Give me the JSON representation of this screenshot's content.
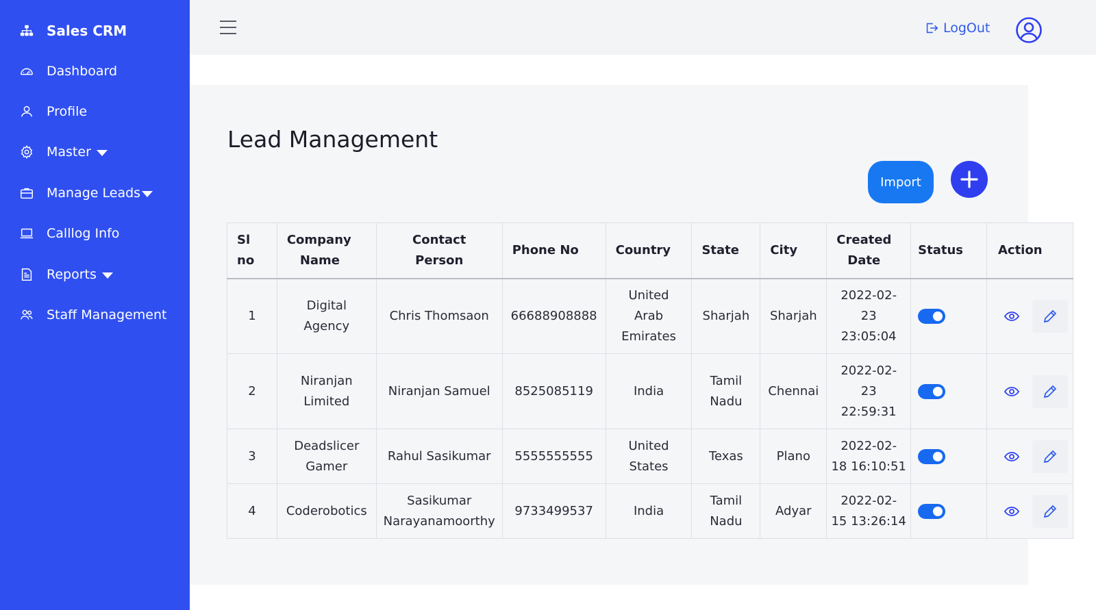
{
  "sidebar": {
    "brand": "Sales CRM",
    "items": [
      {
        "label": "Dashboard"
      },
      {
        "label": "Profile"
      },
      {
        "label": "Master"
      },
      {
        "label": "Manage Leads"
      },
      {
        "label": "Calllog Info"
      },
      {
        "label": "Reports"
      },
      {
        "label": "Staff Management"
      }
    ]
  },
  "topbar": {
    "logout_label": "LogOut"
  },
  "main": {
    "title": "Lead Management",
    "import_label": "Import",
    "add_label": "+"
  },
  "table": {
    "headers": {
      "sl_no_1": "Sl",
      "sl_no_2": "no",
      "company_1": "Company",
      "company_2": "Name",
      "contact_1": "Contact",
      "contact_2": "Person",
      "phone": "Phone No",
      "country": "Country",
      "state": "State",
      "city": "City",
      "created_1": "Created",
      "created_2": "Date",
      "status": "Status",
      "action": "Action"
    },
    "rows": [
      {
        "sl": "1",
        "company": [
          "Digital",
          "Agency"
        ],
        "contact": [
          "Chris Thomsaon"
        ],
        "phone": "66688908888",
        "country": [
          "United",
          "Arab",
          "Emirates"
        ],
        "state": [
          "Sharjah"
        ],
        "city": "Sharjah",
        "created": [
          "2022-02-",
          "23",
          "23:05:04"
        ],
        "status_on": true
      },
      {
        "sl": "2",
        "company": [
          "Niranjan",
          "Limited"
        ],
        "contact": [
          "Niranjan Samuel"
        ],
        "phone": "8525085119",
        "country": [
          "India"
        ],
        "state": [
          "Tamil",
          "Nadu"
        ],
        "city": "Chennai",
        "created": [
          "2022-02-",
          "23",
          "22:59:31"
        ],
        "status_on": true
      },
      {
        "sl": "3",
        "company": [
          "Deadslicer",
          "Gamer"
        ],
        "contact": [
          "Rahul Sasikumar"
        ],
        "phone": "5555555555",
        "country": [
          "United",
          "States"
        ],
        "state": [
          "Texas"
        ],
        "city": "Plano",
        "created": [
          "2022-02-",
          "18 16:10:51"
        ],
        "status_on": true
      },
      {
        "sl": "4",
        "company": [
          "Coderobotics"
        ],
        "contact": [
          "Sasikumar",
          "Narayanamoorthy"
        ],
        "phone": "9733499537",
        "country": [
          "India"
        ],
        "state": [
          "Tamil",
          "Nadu"
        ],
        "city": "Adyar",
        "created": [
          "2022-02-",
          "15 13:26:14"
        ],
        "status_on": true
      }
    ]
  },
  "colors": {
    "sidebar": "#2f4ff0",
    "import_button": "#1778f2",
    "add_button": "#2f3ff0",
    "toggle_on": "#1769f0",
    "link": "#2f5bea"
  },
  "icons": {
    "brand": "sitemap-icon",
    "dashboard": "gauge-icon",
    "profile": "user-icon",
    "master": "gear-icon",
    "manage_leads": "briefcase-icon",
    "calllog": "laptop-icon",
    "reports": "report-icon",
    "staff": "users-icon",
    "logout": "logout-icon",
    "avatar": "user-circle-icon",
    "view": "eye-icon",
    "edit": "pencil-icon"
  }
}
